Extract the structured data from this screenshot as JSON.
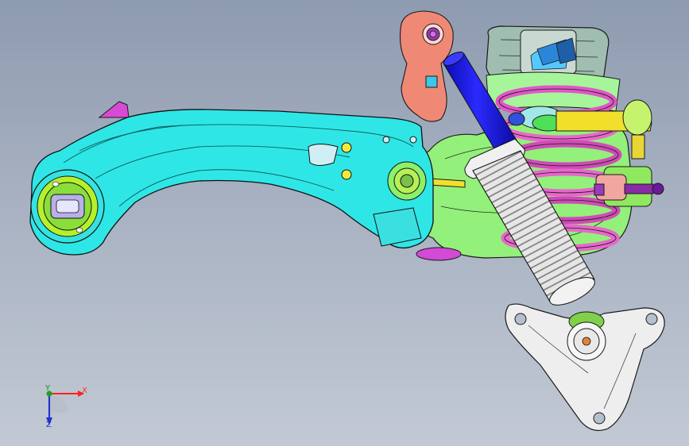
{
  "viewport": {
    "background_top": "#8e9bb0",
    "background_bottom": "#c2c9d4"
  },
  "model": {
    "parts": [
      {
        "name": "trailing-arm",
        "color": "#2fe6e6"
      },
      {
        "name": "arm-bushing",
        "color": "#b8f02c"
      },
      {
        "name": "knuckle",
        "color": "#8ff064"
      },
      {
        "name": "coil-spring",
        "color": "#e860c8"
      },
      {
        "name": "damper-body",
        "color": "#1a1aff"
      },
      {
        "name": "dust-boot",
        "color": "#dcdcdc"
      },
      {
        "name": "upper-mount-bracket",
        "color": "#f2927a"
      },
      {
        "name": "lower-mount-bracket",
        "color": "#ececec"
      },
      {
        "name": "stabilizer-link",
        "color": "#f2e02c"
      },
      {
        "name": "top-mount",
        "color": "#8fb8a8"
      }
    ]
  },
  "triad": {
    "x_label": "X",
    "y_label": "Y",
    "z_label": "Z",
    "x_color": "#ff3030",
    "y_color": "#1c8a1c",
    "z_color": "#2233cc"
  }
}
